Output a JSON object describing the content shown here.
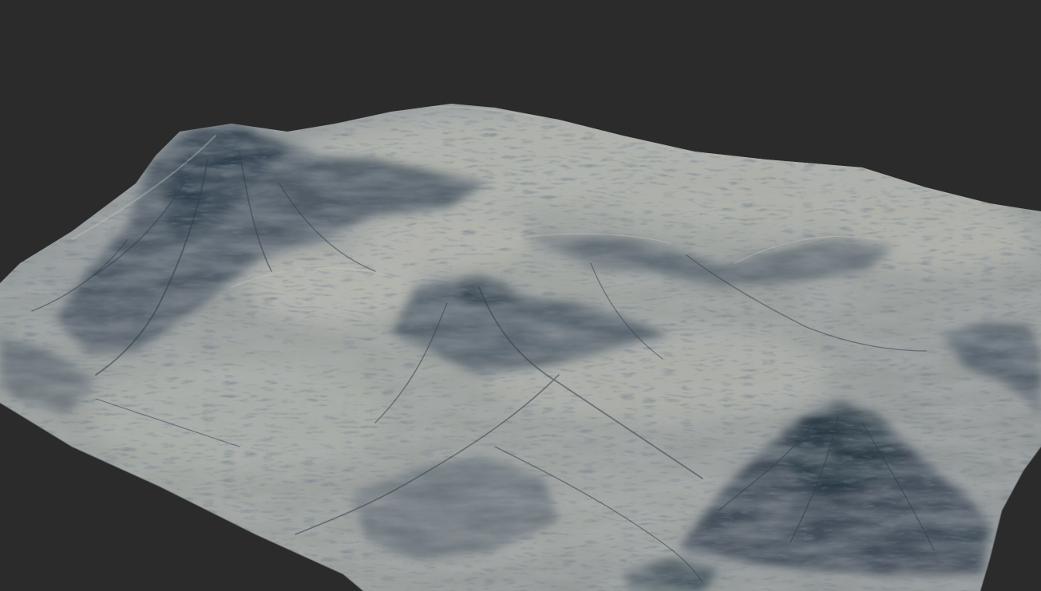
{
  "viewport": {
    "background_color": "#2b2b2b",
    "terrain_light_color": "#a6aaa4",
    "terrain_mid_color": "#7d838a",
    "terrain_shadow_color": "#2c3a47"
  }
}
